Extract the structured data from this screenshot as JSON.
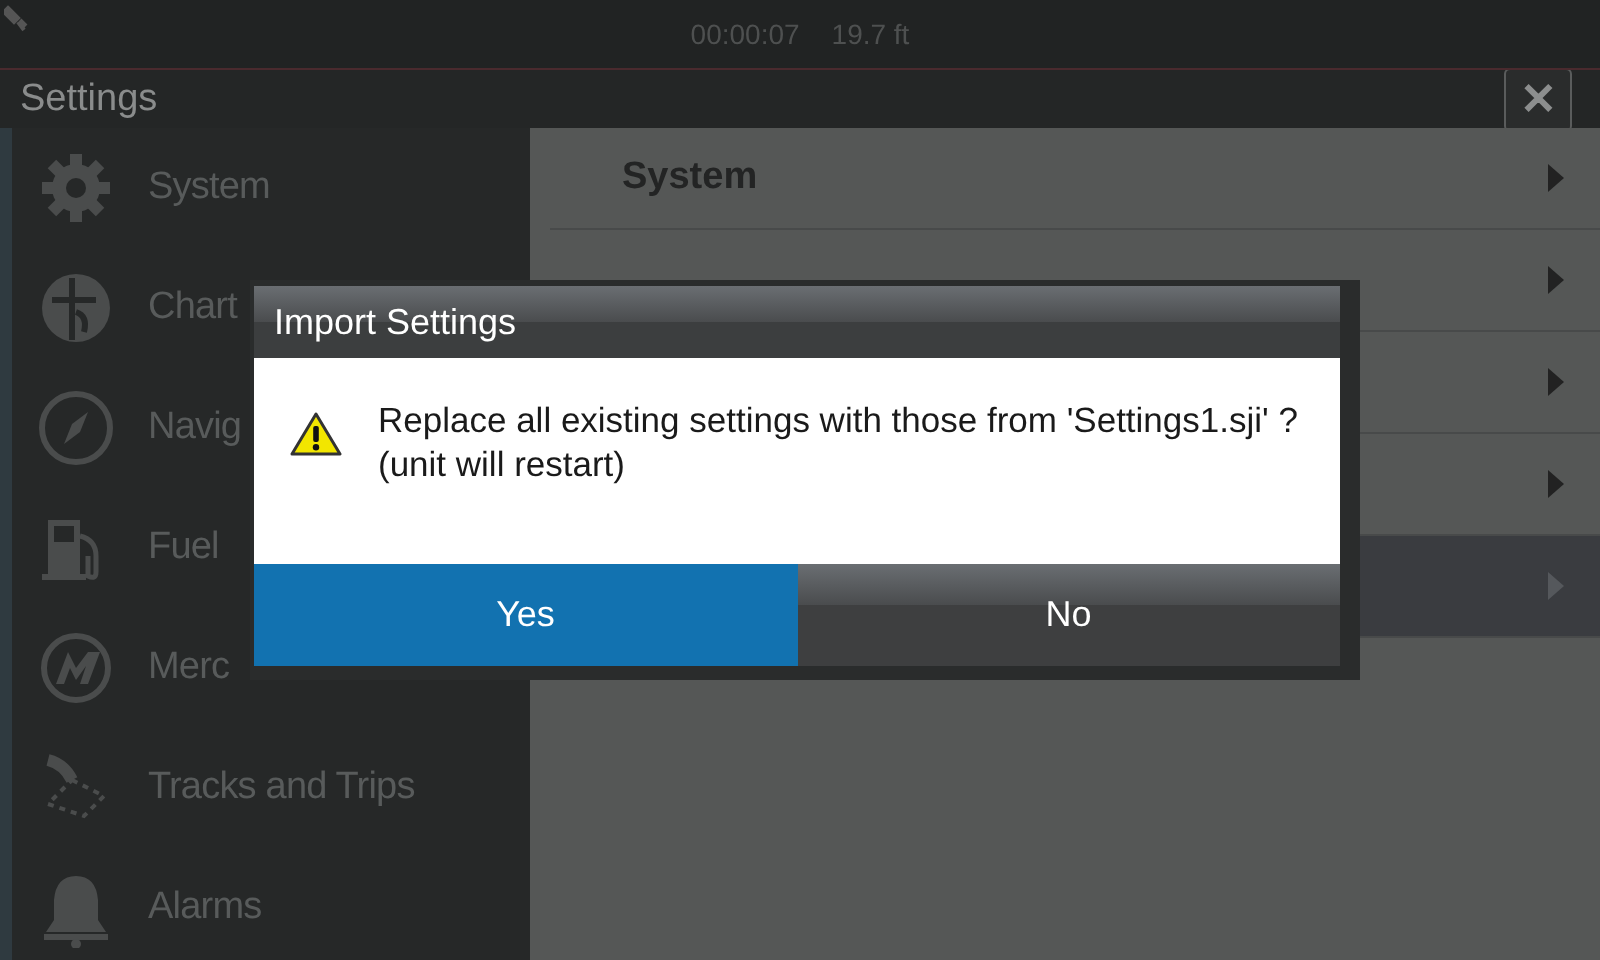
{
  "status_bar": {
    "time": "00:00:07",
    "depth": "19.7 ft"
  },
  "header": {
    "title": "Settings",
    "close": "✕"
  },
  "sidebar": {
    "items": [
      {
        "label": "System"
      },
      {
        "label": "Chart"
      },
      {
        "label": "Navig"
      },
      {
        "label": "Fuel"
      },
      {
        "label": "Merc"
      },
      {
        "label": "Tracks and Trips"
      },
      {
        "label": "Alarms"
      }
    ]
  },
  "panel": {
    "rows": [
      {
        "label": "System",
        "selected": false
      },
      {
        "selected": false
      },
      {
        "selected": false
      },
      {
        "selected": false
      },
      {
        "selected": true
      }
    ]
  },
  "dialog": {
    "title": "Import Settings",
    "message": "Replace all existing settings with those from 'Settings1.sji' ?",
    "note": "(unit will restart)",
    "buttons": [
      {
        "label": "Yes",
        "selected": true
      },
      {
        "label": "No",
        "selected": false
      }
    ]
  }
}
